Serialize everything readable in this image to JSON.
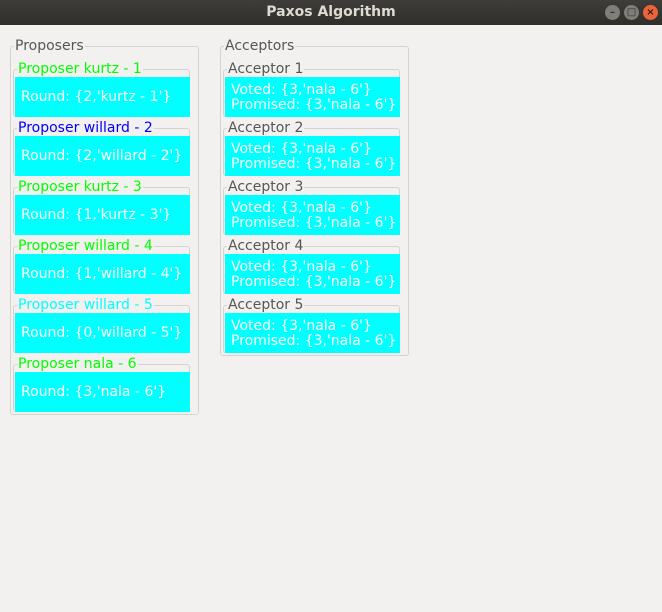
{
  "window": {
    "title": "Paxos Algorithm"
  },
  "proposers_group": {
    "title": "Proposers",
    "items": [
      {
        "title": "Proposer kurtz - 1",
        "round": "Round: {2,'kurtz - 1'}",
        "title_color": "#00ff00"
      },
      {
        "title": "Proposer willard - 2",
        "round": "Round: {2,'willard - 2'}",
        "title_color": "#0000ff"
      },
      {
        "title": "Proposer kurtz - 3",
        "round": "Round: {1,'kurtz - 3'}",
        "title_color": "#00ff00"
      },
      {
        "title": "Proposer willard - 4",
        "round": "Round: {1,'willard - 4'}",
        "title_color": "#00ff00"
      },
      {
        "title": "Proposer willard - 5",
        "round": "Round: {0,'willard - 5'}",
        "title_color": "#00ffff"
      },
      {
        "title": "Proposer nala - 6",
        "round": "Round: {3,'nala - 6'}",
        "title_color": "#00ff00"
      }
    ]
  },
  "acceptors_group": {
    "title": "Acceptors",
    "items": [
      {
        "title": "Acceptor 1",
        "voted": "Voted: {3,'nala - 6'}",
        "promised": "Promised: {3,'nala - 6'}"
      },
      {
        "title": "Acceptor 2",
        "voted": "Voted: {3,'nala - 6'}",
        "promised": "Promised: {3,'nala - 6'}"
      },
      {
        "title": "Acceptor 3",
        "voted": "Voted: {3,'nala - 6'}",
        "promised": "Promised: {3,'nala - 6'}"
      },
      {
        "title": "Acceptor 4",
        "voted": "Voted: {3,'nala - 6'}",
        "promised": "Promised: {3,'nala - 6'}"
      },
      {
        "title": "Acceptor 5",
        "voted": "Voted: {3,'nala - 6'}",
        "promised": "Promised: {3,'nala - 6'}"
      }
    ]
  },
  "colors": {
    "panel_fill": "#00ffff",
    "panel_text": "#ffffff",
    "window_bg": "#f2f1f0"
  }
}
